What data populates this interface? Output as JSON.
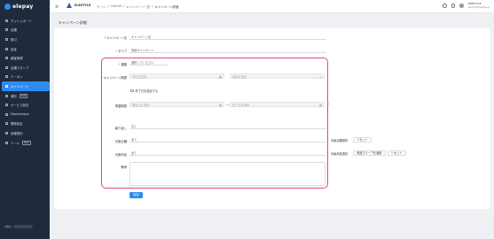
{
  "sidebar": {
    "logo": "elepay",
    "items": [
      {
        "label": "ダッシュボード",
        "icon": "dashboard-icon"
      },
      {
        "label": "店舗",
        "icon": "store-icon"
      },
      {
        "label": "取引",
        "icon": "transaction-icon",
        "chevron": "›"
      },
      {
        "label": "返金",
        "icon": "refund-icon"
      },
      {
        "label": "顧客管理",
        "icon": "customer-icon",
        "chevron": "›"
      },
      {
        "label": "店舗スタンプ",
        "icon": "stamp-icon"
      },
      {
        "label": "クーポン",
        "icon": "coupon-icon"
      },
      {
        "label": "キャンペーン",
        "icon": "campaign-icon",
        "active": true
      },
      {
        "label": "通知",
        "icon": "notification-icon",
        "badge": "Beta"
      },
      {
        "label": "サービス設定",
        "icon": "service-icon",
        "chevron": "›"
      },
      {
        "label": "Marketplace",
        "icon": "marketplace-icon"
      },
      {
        "label": "開発設定",
        "icon": "developer-icon",
        "chevron": "›"
      },
      {
        "label": "各種規約",
        "icon": "terms-icon"
      },
      {
        "label": "ツール",
        "icon": "tool-icon",
        "badge": "Beta"
      }
    ],
    "footer_label": "本番用"
  },
  "header": {
    "brand": "ELESTYLE",
    "breadcrumb": [
      "ホーム",
      "/",
      "CiteGift",
      "/",
      "キャンペーン一覧",
      "/",
      "キャンペーン詳細"
    ],
    "user_name": "ELESTYLE",
    "user_email": "admin@elestyle.jp"
  },
  "page": {
    "title": "キャンペーン詳細",
    "save_label": "保存"
  },
  "form": {
    "name_label": "キャンペーン名",
    "name_value": "キャンペーン名",
    "type_label": "タイプ",
    "type_value": "商品キャンペーン",
    "kind_label": "種類",
    "kind_value": "選択してください",
    "period_label": "キャンペーン期間",
    "period_start_placeholder": "日付を選択",
    "period_end_placeholder": "時刻を選択",
    "no_end_label": "終了日を設定する",
    "exposure_label": "掲載期間",
    "exposure_start_placeholder": "開始日を選択",
    "exposure_separator": "〜",
    "exposure_end_placeholder": "終了日を選択",
    "exposure_help": "?",
    "exposure_dash": "-",
    "repeat_label": "繰り返し",
    "repeat_value": "なし",
    "target_store_label": "対象店舗",
    "target_store_value": "全て",
    "target_store_select": "対象店舗選択",
    "target_store_reset": "リセット",
    "target_product_label": "対象商品",
    "target_product_value": "全て",
    "target_product_select": "対象商品選択",
    "target_product_group": "商品グループを適用",
    "target_product_reset": "リセット",
    "memo_label": "備考",
    "required_mark": "*"
  }
}
